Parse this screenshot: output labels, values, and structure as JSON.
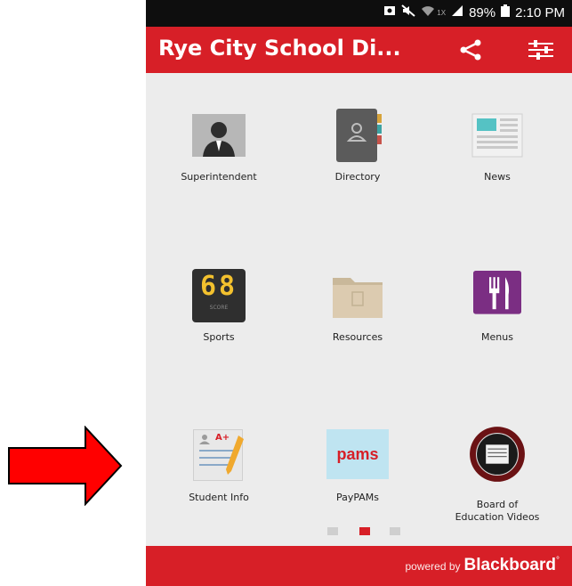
{
  "status_bar": {
    "battery": "89%",
    "time": "2:10 PM",
    "signal_badge": "1X"
  },
  "app_bar": {
    "title": "Rye City School Di...",
    "icons": [
      "share-icon",
      "filter-icon"
    ]
  },
  "tiles": [
    {
      "label": "Superintendent",
      "icon": "person-photo-icon"
    },
    {
      "label": "Directory",
      "icon": "address-book-icon"
    },
    {
      "label": "News",
      "icon": "newspaper-icon"
    },
    {
      "label": "Sports",
      "icon": "scoreboard-icon",
      "score": "68",
      "score_caption": "SCORE"
    },
    {
      "label": "Resources",
      "icon": "folder-icon"
    },
    {
      "label": "Menus",
      "icon": "fork-knife-icon"
    },
    {
      "label": "Student Info",
      "icon": "report-card-icon",
      "grade": "A+"
    },
    {
      "label": "PayPAMs",
      "icon": "pams-logo-icon",
      "logo_text": "pams"
    },
    {
      "label": "Board of Education Videos",
      "label_lines": [
        "Board of",
        "Education Videos"
      ],
      "icon": "district-seal-icon"
    }
  ],
  "pager": {
    "count": 3,
    "active_index": 1
  },
  "footer": {
    "powered_by": "powered by",
    "brand": "Blackboard",
    "brand_mark": "°"
  },
  "colors": {
    "brand_red": "#d71f27",
    "status_black": "#0e0e0e",
    "background": "#ececec",
    "arrow_red": "#ff0000"
  }
}
